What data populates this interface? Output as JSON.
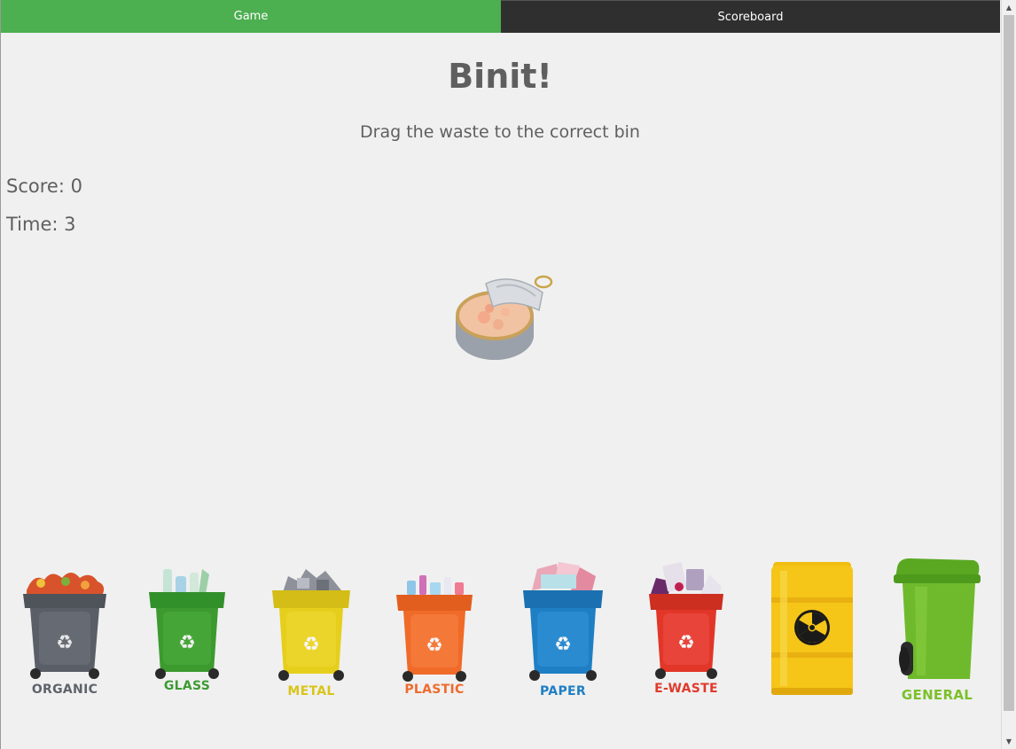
{
  "tabs": {
    "game": "Game",
    "scoreboard": "Scoreboard"
  },
  "title": "Binit!",
  "subtitle": "Drag the waste to the correct bin",
  "score": {
    "label": "Score:",
    "value": "0"
  },
  "time": {
    "label": "Time:",
    "value": "3"
  },
  "current_waste": "tin-can",
  "bins": {
    "organic": {
      "label": "ORGANIC",
      "color": "#5a5e66",
      "label_color": "#5f636b"
    },
    "glass": {
      "label": "GLASS",
      "color": "#3c9a2f",
      "label_color": "#3d9a33"
    },
    "metal": {
      "label": "METAL",
      "color": "#e6cf1c",
      "label_color": "#d8c51a"
    },
    "plastic": {
      "label": "PLASTIC",
      "color": "#f06a28",
      "label_color": "#ef6a2d"
    },
    "paper": {
      "label": "PAPER",
      "color": "#1f7fc4",
      "label_color": "#1f7fc4"
    },
    "ewaste": {
      "label": "E-WASTE",
      "color": "#e23628",
      "label_color": "#e03a2c"
    },
    "hazardous": {
      "icon": "radiation-icon",
      "color": "#f5c518"
    },
    "general": {
      "label": "GENERAL",
      "color": "#6fba2c",
      "label_color": "#7cc02a"
    }
  }
}
